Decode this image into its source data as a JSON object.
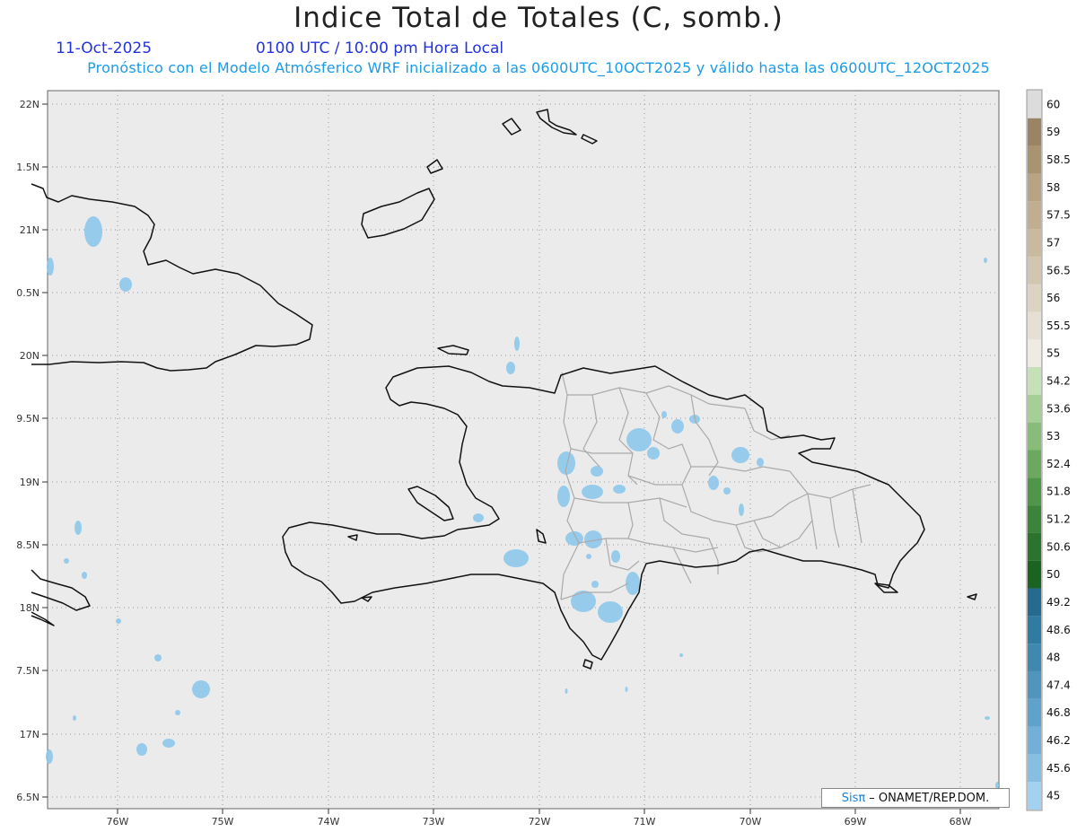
{
  "header": {
    "title": "Indice Total de Totales (C, somb.)",
    "date": "11-Oct-2025",
    "time": "0100 UTC / 10:00 pm Hora Local",
    "subtitle": "Pronóstico con el Modelo Atmósferico WRF inicializado a las 0600UTC_10OCT2025 y válido hasta las  0600UTC_12OCT2025"
  },
  "axes": {
    "lat_labels": [
      "22N",
      "1.5N",
      "21N",
      "0.5N",
      "20N",
      "9.5N",
      "19N",
      "8.5N",
      "18N",
      "7.5N",
      "17N",
      "6.5N"
    ],
    "lon_labels": [
      "76W",
      "75W",
      "74W",
      "73W",
      "72W",
      "71W",
      "70W",
      "69W",
      "68W"
    ]
  },
  "colorbar": {
    "labels": [
      "60",
      "59",
      "58.5",
      "58",
      "57.5",
      "57",
      "56.5",
      "56",
      "55.5",
      "55",
      "54.2",
      "53.6",
      "53",
      "52.4",
      "51.8",
      "51.2",
      "50.6",
      "50",
      "49.2",
      "48.6",
      "48",
      "47.4",
      "46.8",
      "46.2",
      "45.6",
      "45"
    ],
    "colors": [
      "#dcdcdc",
      "#9a8463",
      "#a99472",
      "#b8a383",
      "#c1ae90",
      "#c9b99e",
      "#d3c6b0",
      "#ddd3c2",
      "#e6dfd3",
      "#efeae2",
      "#c6e0b8",
      "#a6cf96",
      "#88bd79",
      "#6aa95f",
      "#4f954a",
      "#3c843a",
      "#2c732d",
      "#1a6320",
      "#246b8f",
      "#2f7ba2",
      "#3f89b0",
      "#4f95be",
      "#5fa2cb",
      "#72b0d7",
      "#86bfe2",
      "#a2d2ef"
    ]
  },
  "credit": {
    "sis": "Sisπ",
    "org": "– ONAMET/REP.DOM."
  }
}
